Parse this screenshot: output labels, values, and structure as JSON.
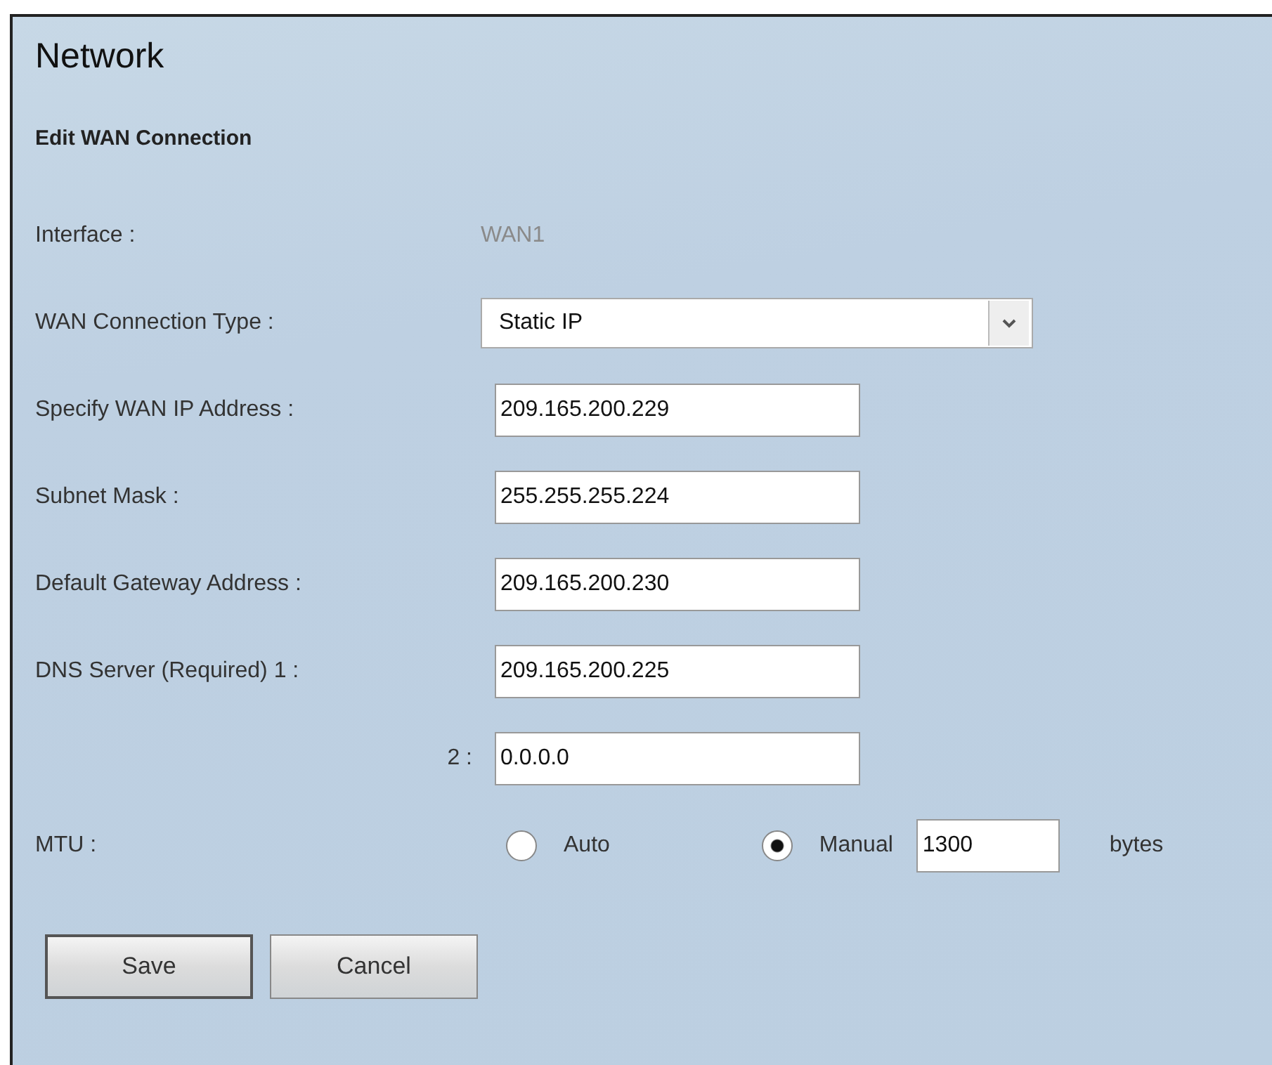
{
  "title": "Network",
  "section_title": "Edit WAN Connection",
  "fields": [
    {
      "kind": "static",
      "label": "Interface :",
      "value": "WAN1"
    },
    {
      "kind": "select",
      "label": "WAN Connection Type :",
      "value": "Static IP"
    },
    {
      "kind": "text",
      "label": "Specify WAN IP Address :",
      "value": "209.165.200.229"
    },
    {
      "kind": "text",
      "label": "Subnet Mask :",
      "value": "255.255.255.224"
    },
    {
      "kind": "text",
      "label": "Default Gateway Address :",
      "value": "209.165.200.230"
    },
    {
      "kind": "text",
      "label": "DNS Server (Required) 1 :",
      "value": "209.165.200.225"
    },
    {
      "kind": "continued",
      "label": "2 :",
      "value": "0.0.0.0"
    },
    {
      "kind": "mtu",
      "label": "MTU :",
      "options": [
        {
          "label": "Auto",
          "selected": false
        },
        {
          "label": "Manual",
          "selected": true
        }
      ],
      "value": "1300",
      "unit": "bytes"
    }
  ],
  "buttons": [
    {
      "label": "Save",
      "default": true
    },
    {
      "label": "Cancel",
      "default": false
    }
  ]
}
